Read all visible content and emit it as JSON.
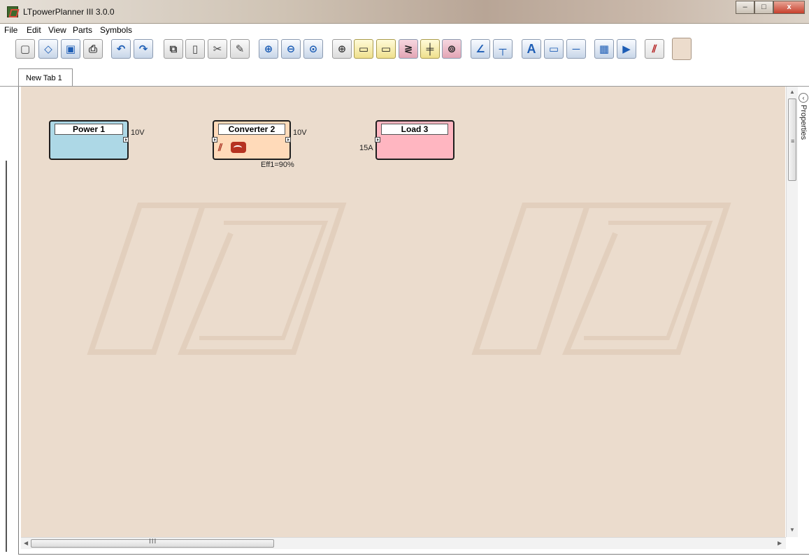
{
  "window": {
    "title": "LTpowerPlanner III 3.0.0",
    "minimize": "–",
    "maximize": "□",
    "close": "x"
  },
  "menu": [
    "File",
    "Edit",
    "View",
    "Parts",
    "Symbols"
  ],
  "toolbar": {
    "buttons": [
      "new-icon",
      "open-icon",
      "save-icon",
      "print-icon",
      "undo-icon",
      "redo-icon",
      "copy-icon",
      "paste-icon",
      "cut-icon",
      "delete-icon",
      "zoom-in-icon",
      "zoom-out-icon",
      "zoom-fit-icon",
      "power-source-icon",
      "converter-icon",
      "ldo-icon",
      "resistor-icon",
      "capacitor-icon",
      "load-icon",
      "wire-icon",
      "junction-icon",
      "text-icon",
      "rectangle-icon",
      "line-icon",
      "calculator-icon",
      "run-icon",
      "lt-logo-icon",
      "color-swatch"
    ],
    "glyphs": {
      "new": "▢",
      "open": "◇",
      "save": "▣",
      "print": "⎙",
      "undo": "↶",
      "redo": "↷",
      "copy": "⧉",
      "paste": "▯",
      "cut": "✂",
      "delete": "✎",
      "zoom_in": "⊕",
      "zoom_out": "⊖",
      "zoom_fit": "⊙",
      "power": "⊕",
      "converter": "▭",
      "ldo": "▭",
      "resistor": "≷",
      "capacitor": "╪",
      "load": "⊚",
      "wire": "∠",
      "junction": "┬",
      "text": "A",
      "rect": "▭",
      "line": "─",
      "calc": "▦",
      "run": "▶",
      "lt": "⫽"
    }
  },
  "tabs": [
    {
      "label": "New Tab 1"
    }
  ],
  "diagram": {
    "power": {
      "title": "Power 1",
      "out_label": "10V",
      "color": "#add8e6"
    },
    "converter": {
      "title": "Converter 2",
      "out_label": "10V",
      "eff_label": "Eff1=90%",
      "color": "#ffdab9"
    },
    "load": {
      "title": "Load 3",
      "in_label": "15A",
      "color": "#ffb6c1"
    }
  },
  "side_panel": {
    "label": "Properties",
    "collapse": "‹"
  },
  "scrollbars": {
    "h_grip": "III",
    "v_grip": "≡"
  },
  "colors": {
    "canvas": "#ebdccd",
    "watermark": "#e2cfbd"
  }
}
